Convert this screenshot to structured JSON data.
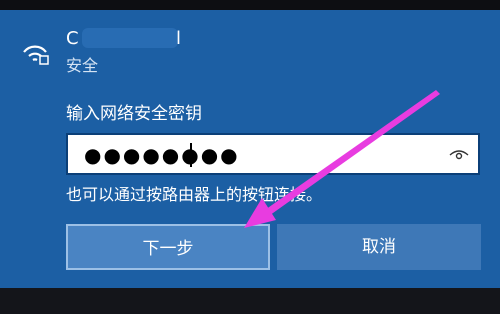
{
  "network": {
    "name_visible_prefix": "C",
    "name_visible_suffix": "l",
    "security": "安全"
  },
  "form": {
    "key_label": "输入网络安全密钥",
    "password_masked": "●●●●●●●●"
  },
  "hint": "也可以通过按路由器上的按钮连接。",
  "buttons": {
    "next": "下一步",
    "cancel": "取消"
  },
  "colors": {
    "panel": "#1c5fa4",
    "button": "#4a84c3",
    "annotation_arrow": "#e83ce0"
  }
}
